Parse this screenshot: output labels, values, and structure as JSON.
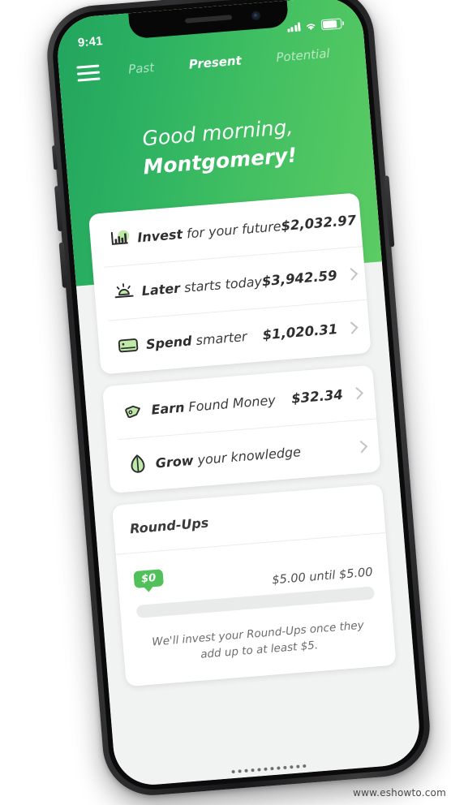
{
  "status_bar": {
    "time": "9:41",
    "signal_icon": "cellular-bars-icon",
    "wifi_icon": "wifi-icon",
    "battery_icon": "battery-full-icon"
  },
  "nav": {
    "menu_icon": "hamburger-menu-icon",
    "tabs": [
      {
        "label": "Past",
        "active": false
      },
      {
        "label": "Present",
        "active": true
      },
      {
        "label": "Potential",
        "active": false
      }
    ]
  },
  "greeting": {
    "line1": "Good morning,",
    "line2": "Montgomery!"
  },
  "accounts_card": {
    "rows": [
      {
        "icon": "bar-chart-icon",
        "label_bold": "Invest",
        "label_rest": " for your future",
        "value": "$2,032.97",
        "chevron": "chevron-right-icon"
      },
      {
        "icon": "sunrise-icon",
        "label_bold": "Later",
        "label_rest": " starts today",
        "value": "$3,942.59",
        "chevron": "chevron-right-icon"
      },
      {
        "icon": "credit-card-icon",
        "label_bold": "Spend",
        "label_rest": " smarter",
        "value": "$1,020.31",
        "chevron": "chevron-right-icon"
      }
    ]
  },
  "extras_card": {
    "rows": [
      {
        "icon": "price-tag-icon",
        "label_bold": "Earn",
        "label_rest": " Found Money",
        "value": "$32.34",
        "chevron": "chevron-right-icon"
      },
      {
        "icon": "leaf-icon",
        "label_bold": "Grow",
        "label_rest": " your knowledge",
        "value": "",
        "chevron": "chevron-right-icon"
      }
    ]
  },
  "round_ups": {
    "title": "Round-Ups",
    "badge": "$0",
    "until_text": "$5.00 until $5.00",
    "progress_percent": 0,
    "footer": "We'll invest your Round-Ups once they add up to at least $5."
  },
  "watermark": "www.eshowto.com",
  "colors": {
    "header_green_dark": "#22a45d",
    "header_green_light": "#5ccc63",
    "accent_green": "#4fc05a",
    "icon_green": "#b9e6a6",
    "page_bg": "#f1f2f2"
  }
}
